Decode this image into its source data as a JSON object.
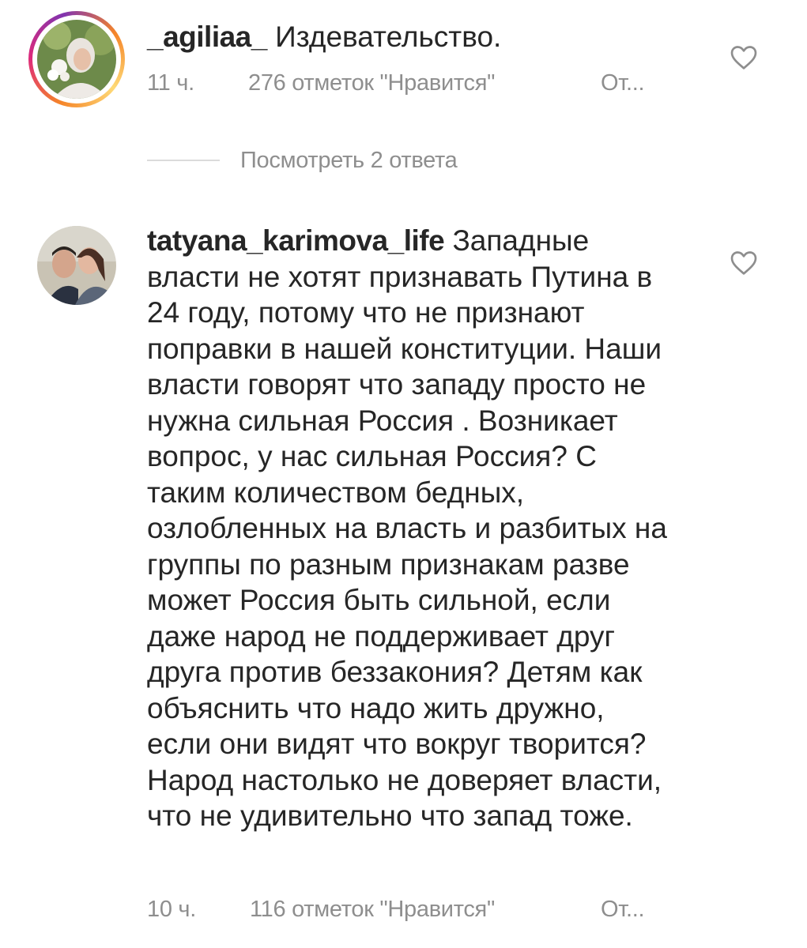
{
  "comments": [
    {
      "username": "_agiliaa_",
      "text": "Издевательство.",
      "time": "11 ч.",
      "likes": "276 отметок \"Нравится\"",
      "reply": "От...",
      "view_replies": "Посмотреть 2 ответа"
    },
    {
      "username": "tatyana_karimova_life",
      "text": "Западные власти не хотят признавать Путина в 24 году, потому что не признают поправки в нашей конституции. Наши власти говорят что западу просто не нужна сильная Россия . Возникает вопрос, у нас сильная Россия? С таким количеством бедных, озлобленных на власть и разбитых на группы по разным признакам разве может Россия быть сильной, если даже народ не поддерживает друг друга против беззакония? Детям как объяснить что надо жить дружно, если они видят что вокруг творится? Народ настолько не доверяет власти, что не удивительно что запад тоже.",
      "time": "10 ч.",
      "likes": "116 отметок \"Нравится\"",
      "reply": "От..."
    }
  ],
  "icons": {
    "like": "heart-outline-icon",
    "story_ring": "story-ring"
  },
  "colors": {
    "text": "#262626",
    "secondary": "#8e8e8e",
    "divider": "#dbdbdb"
  }
}
